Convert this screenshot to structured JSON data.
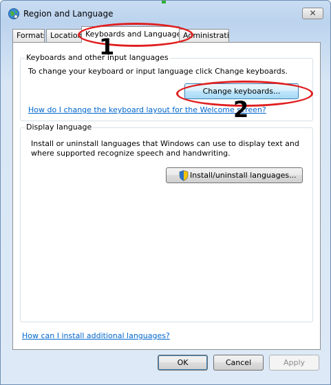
{
  "window": {
    "title": "Region and Language",
    "close_glyph": "✕"
  },
  "tabs": [
    {
      "label": "Formats"
    },
    {
      "label": "Location"
    },
    {
      "label": "Keyboards and Languages",
      "selected": true
    },
    {
      "label": "Administrative"
    }
  ],
  "keyboards_group": {
    "title": "Keyboards and other input languages",
    "description": "To change your keyboard or input language click Change keyboards.",
    "change_button": "Change keyboards...",
    "help_link": "How do I change the keyboard layout for the Welcome screen?"
  },
  "display_group": {
    "title": "Display language",
    "description_line1": "Install or uninstall languages that Windows can use to display text and",
    "description_line2": "where supported recognize speech and handwriting.",
    "install_button": "Install/uninstall languages...",
    "install_button_icon": "uac-shield-icon"
  },
  "additional_link": "How can I install additional languages?",
  "footer": {
    "ok": "OK",
    "cancel": "Cancel",
    "apply": "Apply"
  },
  "annotations": {
    "marker1": "1",
    "marker2": "2",
    "color": "#e01f1f"
  }
}
